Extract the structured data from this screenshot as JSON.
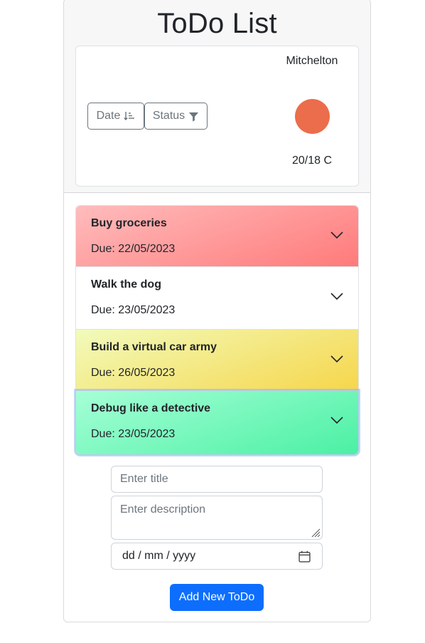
{
  "header": {
    "title": "ToDo List"
  },
  "controls": {
    "sort_label": "Date",
    "sort_icon": "sort-down-icon",
    "filter_label": "Status",
    "filter_icon": "funnel-icon"
  },
  "weather": {
    "location": "Mitchelton",
    "temperature": "20/18 C",
    "indicator_color": "#ec6d4b"
  },
  "todos": [
    {
      "title": "Buy groceries",
      "due": "Due: 22/05/2023",
      "color": "red"
    },
    {
      "title": "Walk the dog",
      "due": "Due: 23/05/2023",
      "color": "white"
    },
    {
      "title": "Build a virtual car army",
      "due": "Due: 26/05/2023",
      "color": "yellow"
    },
    {
      "title": "Debug like a detective",
      "due": "Due: 23/05/2023",
      "color": "green"
    }
  ],
  "form": {
    "title_placeholder": "Enter title",
    "description_placeholder": "Enter description",
    "date_placeholder": "dd / mm / yyyy",
    "submit_label": "Add New ToDo"
  },
  "colors": {
    "primary": "#0d6efd",
    "overdue": "#ff7a7a",
    "due_soon": "#f6d64b",
    "done": "#4bf0a4"
  }
}
